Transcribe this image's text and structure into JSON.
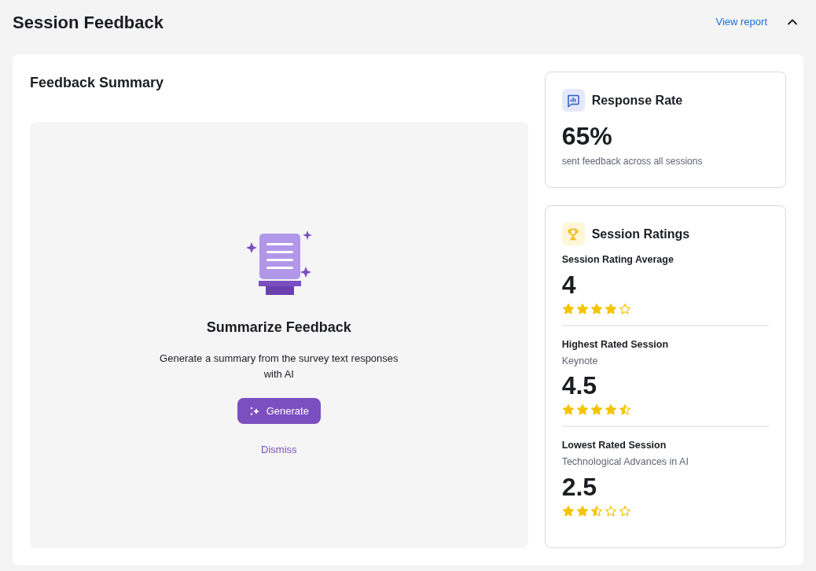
{
  "header": {
    "title": "Session Feedback",
    "link": "View report",
    "expanded": true
  },
  "summary": {
    "title": "Feedback Summary",
    "heading": "Summarize Feedback",
    "description": "Generate a summary from the survey text responses with AI",
    "primary_button": "Generate",
    "secondary_link": "Dismiss"
  },
  "response_rate": {
    "title": "Response Rate",
    "value": "65%",
    "caption": "sent feedback across all sessions"
  },
  "ratings": {
    "title": "Session Ratings",
    "items": [
      {
        "label": "Session Rating Average",
        "value": "4",
        "stars": 4
      },
      {
        "label": "Highest Rated Session",
        "session": "Keynote",
        "value": "4.5",
        "stars": 4.5
      },
      {
        "label": "Lowest Rated Session",
        "session": "Technological Advances in AI",
        "value": "2.5",
        "stars": 2.5
      }
    ]
  }
}
